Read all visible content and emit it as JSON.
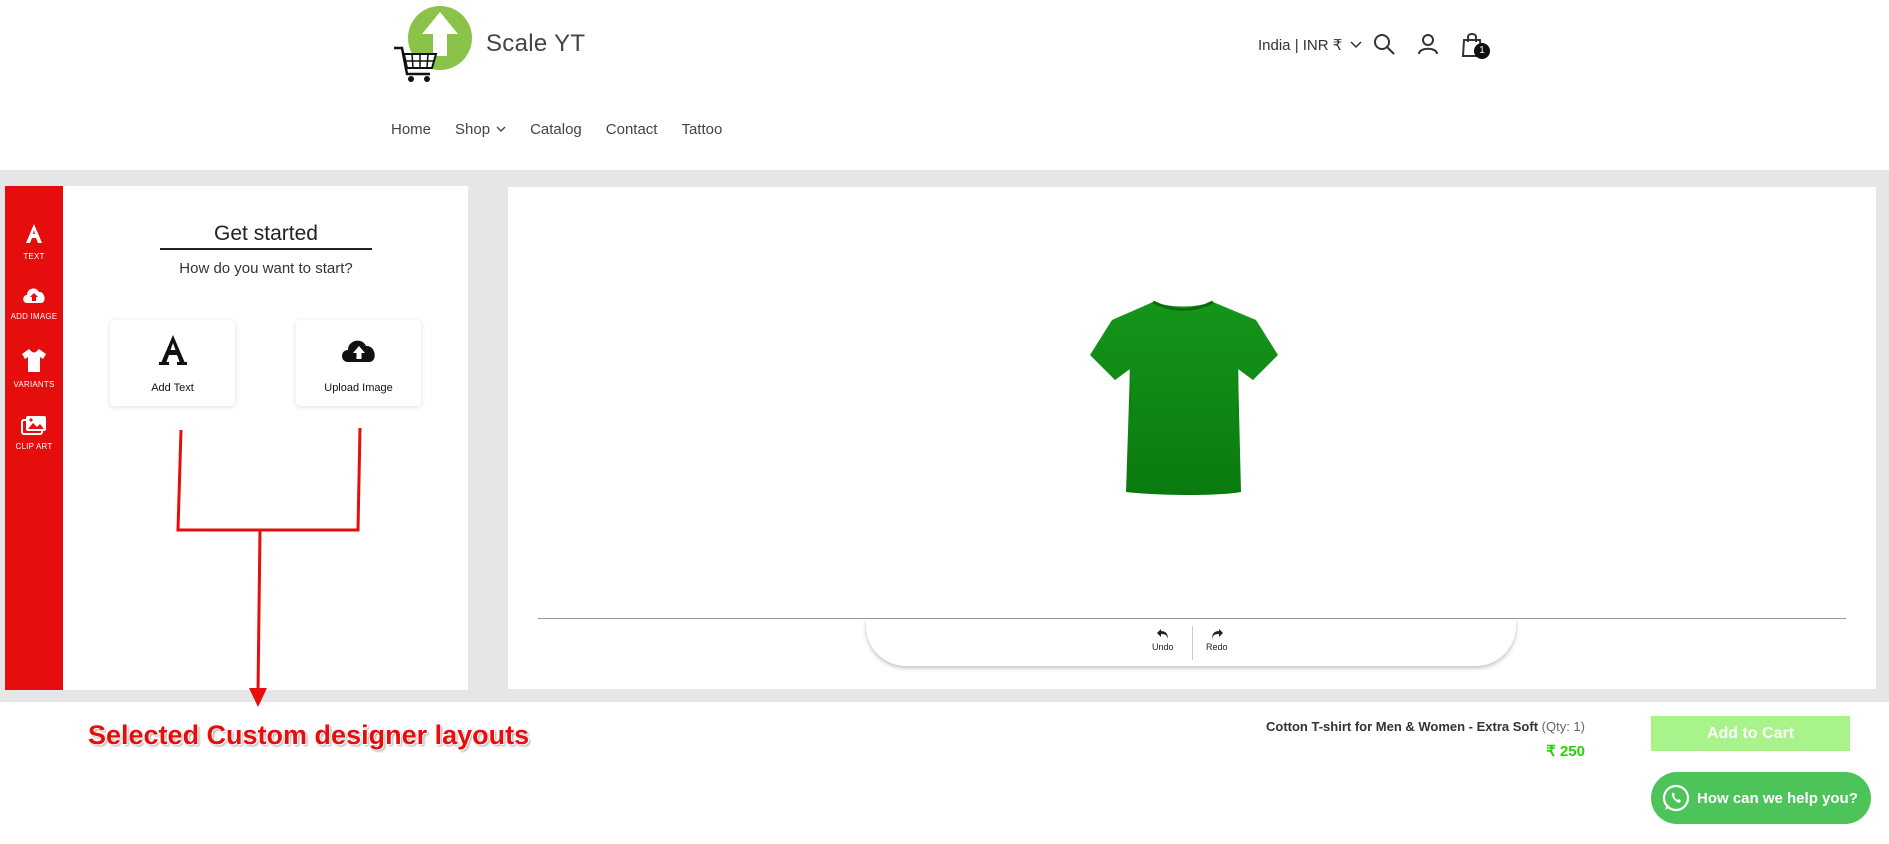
{
  "header": {
    "brand": "Scale YT",
    "locale": "India | INR ₹",
    "cart_count": "1",
    "icons": [
      "search-icon",
      "account-icon",
      "cart-icon"
    ]
  },
  "nav": {
    "items": [
      "Home",
      "Shop",
      "Catalog",
      "Contact",
      "Tattoo"
    ]
  },
  "sidebar": {
    "items": [
      {
        "label": "TEXT",
        "icon": "text-icon"
      },
      {
        "label": "ADD IMAGE",
        "icon": "cloud-upload-icon"
      },
      {
        "label": "VARIANTS",
        "icon": "tshirt-icon"
      },
      {
        "label": "CLIP ART",
        "icon": "images-icon"
      }
    ]
  },
  "panel": {
    "title": "Get started",
    "subtitle": "How do you want to start?",
    "options": [
      {
        "label": "Add Text",
        "icon": "text-icon"
      },
      {
        "label": "Upload Image",
        "icon": "cloud-upload-icon"
      }
    ]
  },
  "canvas": {
    "undo_label": "Undo",
    "redo_label": "Redo",
    "shirt_color": "#0e8a12"
  },
  "footer": {
    "product_name": "Cotton T-shirt for Men & Women - Extra Soft",
    "qty": "(Qty: 1)",
    "price": "₹ 250",
    "add_to_cart": "Add to Cart",
    "help": "How can we help you?"
  },
  "annotation": {
    "text": "Selected Custom designer layouts"
  },
  "colors": {
    "accent": "#e60d0d",
    "price": "#25d300",
    "cart_button": "#a8f38a",
    "whatsapp": "#4dc45a",
    "logo_green": "#8bc34a"
  }
}
